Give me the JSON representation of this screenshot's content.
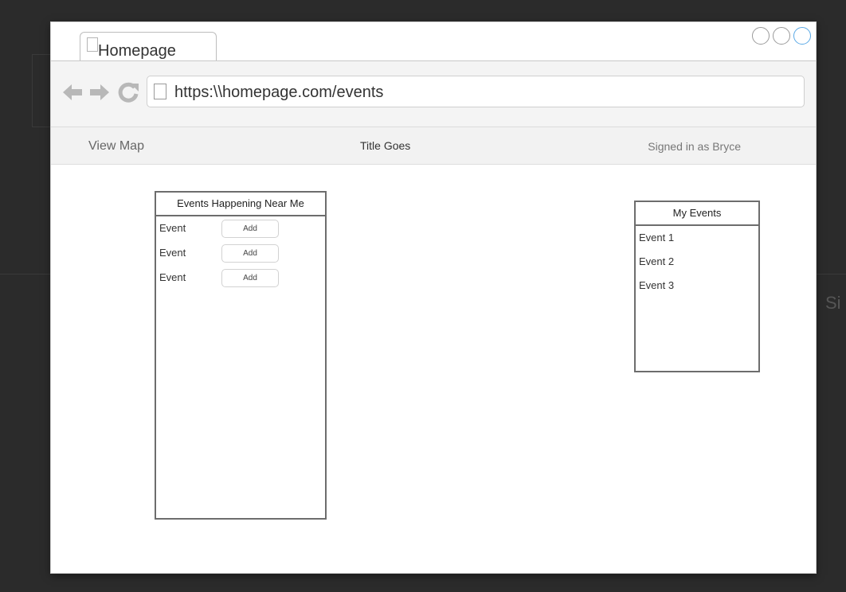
{
  "browser": {
    "tab_title": "Homepage",
    "url": "https:\\\\homepage.com/events"
  },
  "navbar": {
    "view_map": "View Map",
    "title": "Title Goes",
    "signed_in": "Signed in as Bryce"
  },
  "nearby_events": {
    "title": "Events Happening Near Me",
    "items": [
      {
        "label": "Event",
        "button": "Add"
      },
      {
        "label": "Event",
        "button": "Add"
      },
      {
        "label": "Event",
        "button": "Add"
      }
    ]
  },
  "my_events": {
    "title": "My Events",
    "items": [
      "Event 1",
      "Event 2",
      "Event 3"
    ]
  },
  "background": {
    "partial_text": "Si"
  },
  "colors": {
    "backdrop": "#2b2b2b",
    "active_window_control": "#5aa9e6"
  }
}
